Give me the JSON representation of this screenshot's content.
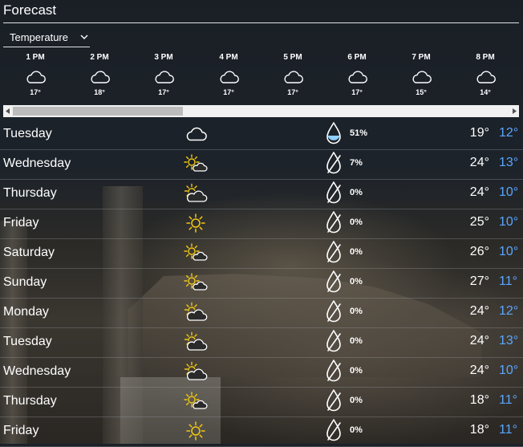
{
  "header": {
    "title": "Forecast"
  },
  "metric_dropdown": {
    "selected": "Temperature"
  },
  "hourly": [
    {
      "time": "1 PM",
      "icon": "cloud-icon",
      "temp": "17°"
    },
    {
      "time": "2 PM",
      "icon": "cloud-icon",
      "temp": "18°"
    },
    {
      "time": "3 PM",
      "icon": "cloud-icon",
      "temp": "17°"
    },
    {
      "time": "4 PM",
      "icon": "cloud-icon",
      "temp": "17°"
    },
    {
      "time": "5 PM",
      "icon": "cloud-icon",
      "temp": "17°"
    },
    {
      "time": "6 PM",
      "icon": "cloud-icon",
      "temp": "17°"
    },
    {
      "time": "7 PM",
      "icon": "cloud-icon",
      "temp": "15°"
    },
    {
      "time": "8 PM",
      "icon": "cloud-icon",
      "temp": "14°"
    }
  ],
  "days": [
    {
      "name": "Tuesday",
      "icon": "cloud-icon",
      "precip": "51%",
      "precip_icon": "raindrop-filled-icon",
      "high": "19°",
      "low": "12°"
    },
    {
      "name": "Wednesday",
      "icon": "partly-sunny-cloud-icon",
      "precip": "7%",
      "precip_icon": "raindrop-icon",
      "high": "24°",
      "low": "13°"
    },
    {
      "name": "Thursday",
      "icon": "partly-cloudy-icon",
      "precip": "0%",
      "precip_icon": "raindrop-icon",
      "high": "24°",
      "low": "10°"
    },
    {
      "name": "Friday",
      "icon": "sun-icon",
      "precip": "0%",
      "precip_icon": "raindrop-icon",
      "high": "25°",
      "low": "10°"
    },
    {
      "name": "Saturday",
      "icon": "partly-sunny-cloud-icon",
      "precip": "0%",
      "precip_icon": "raindrop-icon",
      "high": "26°",
      "low": "10°"
    },
    {
      "name": "Sunday",
      "icon": "partly-sunny-cloud-icon",
      "precip": "0%",
      "precip_icon": "raindrop-icon",
      "high": "27°",
      "low": "11°"
    },
    {
      "name": "Monday",
      "icon": "partly-cloudy-icon",
      "precip": "0%",
      "precip_icon": "raindrop-icon",
      "high": "24°",
      "low": "12°"
    },
    {
      "name": "Tuesday",
      "icon": "partly-cloudy-icon",
      "precip": "0%",
      "precip_icon": "raindrop-icon",
      "high": "24°",
      "low": "13°"
    },
    {
      "name": "Wednesday",
      "icon": "partly-cloudy-icon",
      "precip": "0%",
      "precip_icon": "raindrop-icon",
      "high": "24°",
      "low": "10°"
    },
    {
      "name": "Thursday",
      "icon": "partly-sunny-cloud-icon",
      "precip": "0%",
      "precip_icon": "raindrop-icon",
      "high": "18°",
      "low": "11°"
    },
    {
      "name": "Friday",
      "icon": "sun-icon",
      "precip": "0%",
      "precip_icon": "raindrop-icon",
      "high": "18°",
      "low": "11°"
    }
  ],
  "colors": {
    "low_temp": "#5aa6ff",
    "sun": "#f2c811",
    "cloud": "#ffffff",
    "rain_fill": "#8fd0ff"
  }
}
